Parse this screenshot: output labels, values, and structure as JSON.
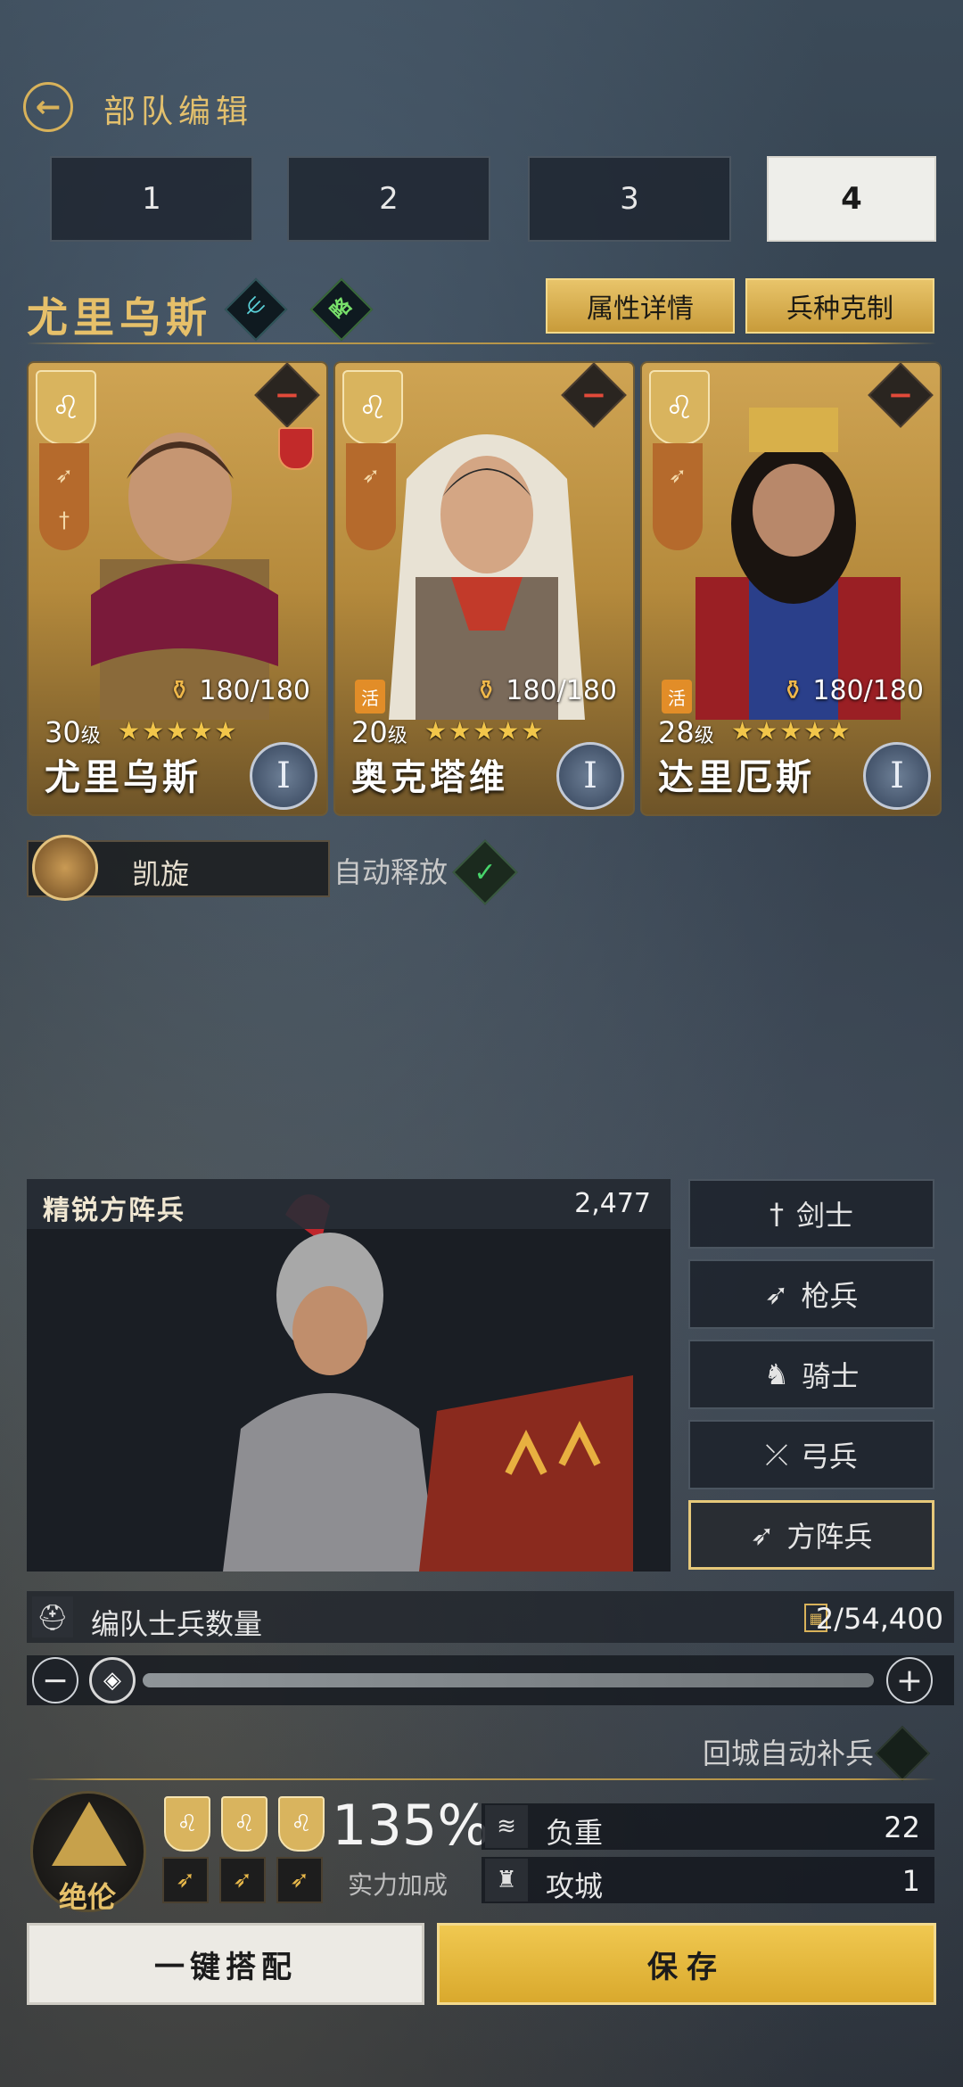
{
  "header": {
    "title": "部队编辑"
  },
  "tabs": [
    "1",
    "2",
    "3",
    "4"
  ],
  "active_tab": "4",
  "commander": {
    "name": "尤里乌斯",
    "strategy_badge": "略",
    "buttons": {
      "attributes": "属性详情",
      "counter": "兵种克制"
    }
  },
  "cards": [
    {
      "name": "尤里乌斯",
      "level": "30",
      "level_unit": "级",
      "stars": "★★★★★",
      "hp": "180/180",
      "rank": "I",
      "active_badge": ""
    },
    {
      "name": "奥克塔维",
      "level": "20",
      "level_unit": "级",
      "stars": "★★★★★",
      "hp": "180/180",
      "rank": "I",
      "active_badge": "活"
    },
    {
      "name": "达里厄斯",
      "level": "28",
      "level_unit": "级",
      "stars": "★★★★★",
      "hp": "180/180",
      "rank": "I",
      "active_badge": "活"
    }
  ],
  "skill": {
    "name": "凯旋",
    "auto_label": "自动释放",
    "auto_enabled": true
  },
  "troop": {
    "name": "精锐方阵兵",
    "count": "2,477",
    "types": [
      "剑士",
      "枪兵",
      "骑士",
      "弓兵",
      "方阵兵"
    ],
    "selected": "方阵兵"
  },
  "soldiers": {
    "label": "编队士兵数量",
    "value": "2/54,400"
  },
  "resupply": {
    "label": "回城自动补兵"
  },
  "formation": {
    "rank_label": "绝伦",
    "power_pct": "135%",
    "power_label": "实力加成",
    "stats": [
      {
        "label": "负重",
        "value": "22"
      },
      {
        "label": "攻城",
        "value": "1"
      }
    ]
  },
  "footer": {
    "auto_match": "一键搭配",
    "save": "保存"
  },
  "colors": {
    "gold": "#d8b25a",
    "accent_green": "#47d36a",
    "danger": "#e24a3a"
  }
}
